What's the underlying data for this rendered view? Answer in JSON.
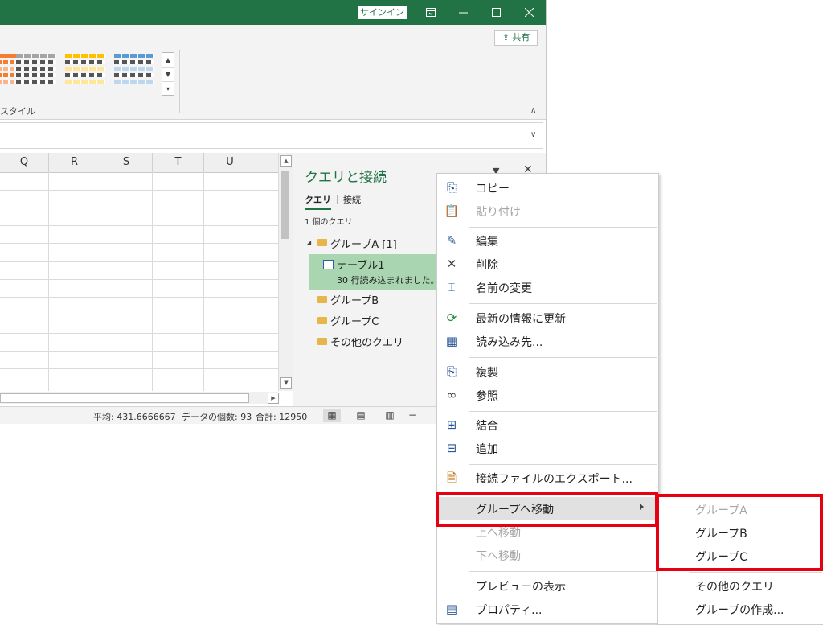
{
  "titlebar": {
    "signin_label": "サインイン",
    "ribbon_display_icon": "ribbon-display-icon",
    "minimize_icon": "minimize-icon",
    "maximize_icon": "maximize-icon",
    "close_icon": "close-icon"
  },
  "ribbon": {
    "share_label": "共有",
    "style_group_label": "スタイル",
    "table_style_colors": [
      "#f47d30",
      "#a5a5a5",
      "#ffc000",
      "#5b9bd5"
    ]
  },
  "grid": {
    "columns": [
      "Q",
      "R",
      "S",
      "T",
      "U"
    ]
  },
  "query_panel": {
    "title": "クエリと接続",
    "tabs": [
      "クエリ",
      "接続"
    ],
    "count_label": "1 個のクエリ",
    "tree": [
      {
        "label": "グループA [1]",
        "type": "group",
        "expanded": true
      },
      {
        "label": "テーブル1",
        "type": "query",
        "detail": "30 行読み込まれました。",
        "selected": true
      },
      {
        "label": "グループB",
        "type": "group"
      },
      {
        "label": "グループC",
        "type": "group"
      },
      {
        "label": "その他のクエリ",
        "type": "group"
      }
    ]
  },
  "statusbar": {
    "average": "平均: 431.6666667",
    "count": "データの個数: 93",
    "sum": "合計: 12950"
  },
  "context_menu": {
    "items": [
      {
        "label": "コピー",
        "icon": "copy-icon",
        "disabled": false
      },
      {
        "label": "貼り付け",
        "icon": "paste-icon",
        "disabled": true
      },
      {
        "label": "編集",
        "icon": "edit-icon",
        "disabled": false
      },
      {
        "label": "削除",
        "icon": "delete-icon",
        "disabled": false
      },
      {
        "label": "名前の変更",
        "icon": "rename-icon",
        "disabled": false
      },
      {
        "label": "最新の情報に更新",
        "icon": "refresh-icon",
        "disabled": false
      },
      {
        "label": "読み込み先...",
        "icon": "load-to-icon",
        "disabled": false
      },
      {
        "label": "複製",
        "icon": "duplicate-icon",
        "disabled": false
      },
      {
        "label": "参照",
        "icon": "reference-icon",
        "disabled": false
      },
      {
        "label": "結合",
        "icon": "merge-icon",
        "disabled": false
      },
      {
        "label": "追加",
        "icon": "append-icon",
        "disabled": false
      },
      {
        "label": "接続ファイルのエクスポート...",
        "icon": "export-connection-icon",
        "disabled": false
      },
      {
        "label": "グループへ移動",
        "icon": "",
        "disabled": false,
        "submenu": true,
        "highlighted": true
      },
      {
        "label": "上へ移動",
        "icon": "",
        "disabled": true
      },
      {
        "label": "下へ移動",
        "icon": "",
        "disabled": true
      },
      {
        "label": "プレビューの表示",
        "icon": "",
        "disabled": false
      },
      {
        "label": "プロパティ...",
        "icon": "properties-icon",
        "disabled": false
      }
    ]
  },
  "submenu": {
    "items": [
      {
        "label": "グループA",
        "disabled": true
      },
      {
        "label": "グループB",
        "disabled": false
      },
      {
        "label": "グループC",
        "disabled": false
      },
      {
        "label": "その他のクエリ",
        "disabled": false
      },
      {
        "label": "グループの作成...",
        "disabled": false
      }
    ]
  },
  "annotation_color": "#e60012"
}
